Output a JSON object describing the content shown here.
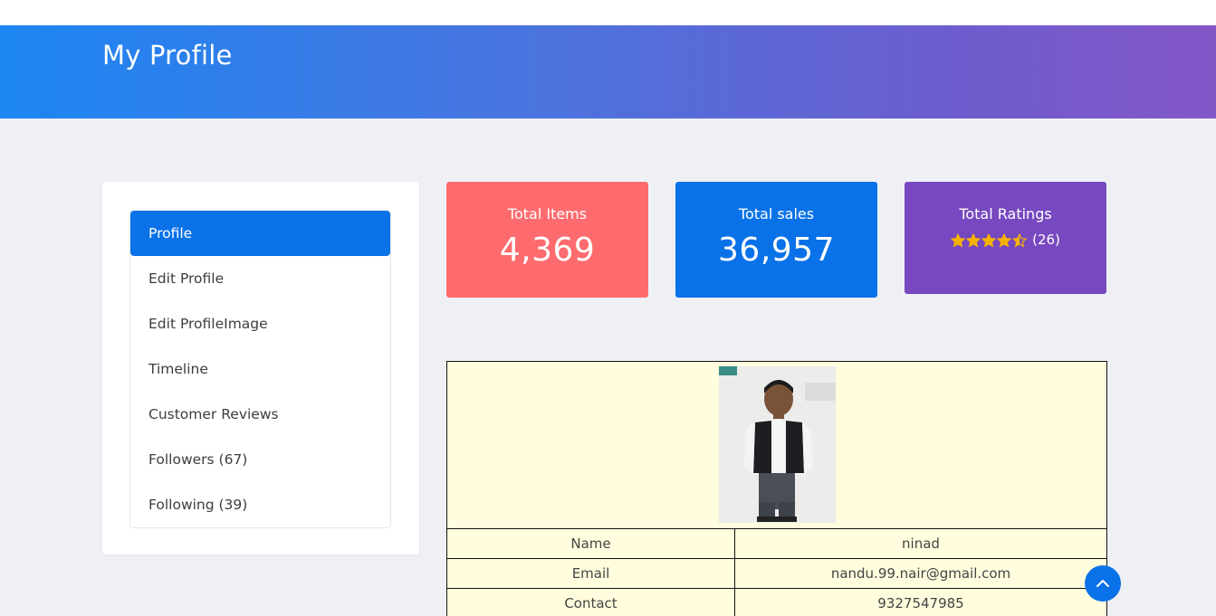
{
  "header": {
    "title": "My Profile"
  },
  "sidebar": {
    "items": [
      {
        "label": "Profile",
        "active": true
      },
      {
        "label": "Edit Profile"
      },
      {
        "label": "Edit ProfileImage"
      },
      {
        "label": "Timeline"
      },
      {
        "label": "Customer Reviews"
      },
      {
        "label": "Followers (67)"
      },
      {
        "label": "Following (39)"
      }
    ]
  },
  "stats": {
    "items": {
      "label": "Total Items",
      "value": "4,369"
    },
    "sales": {
      "label": "Total sales",
      "value": "36,957"
    },
    "ratings": {
      "label": "Total Ratings",
      "stars": 4.5,
      "count": "(26)"
    }
  },
  "profile": {
    "name_label": "Name",
    "name_value": "ninad",
    "email_label": "Email",
    "email_value": "nandu.99.nair@gmail.com",
    "contact_label": "Contact",
    "contact_value": "9327547985"
  },
  "colors": {
    "primary": "#0b72e7",
    "items_card": "#fe6b6e",
    "ratings_card": "#7748c0",
    "star": "#f5b301",
    "table_bg": "#fffddd"
  },
  "icons": {
    "scroll_top": "chevron-up-icon",
    "star": "star-icon"
  }
}
